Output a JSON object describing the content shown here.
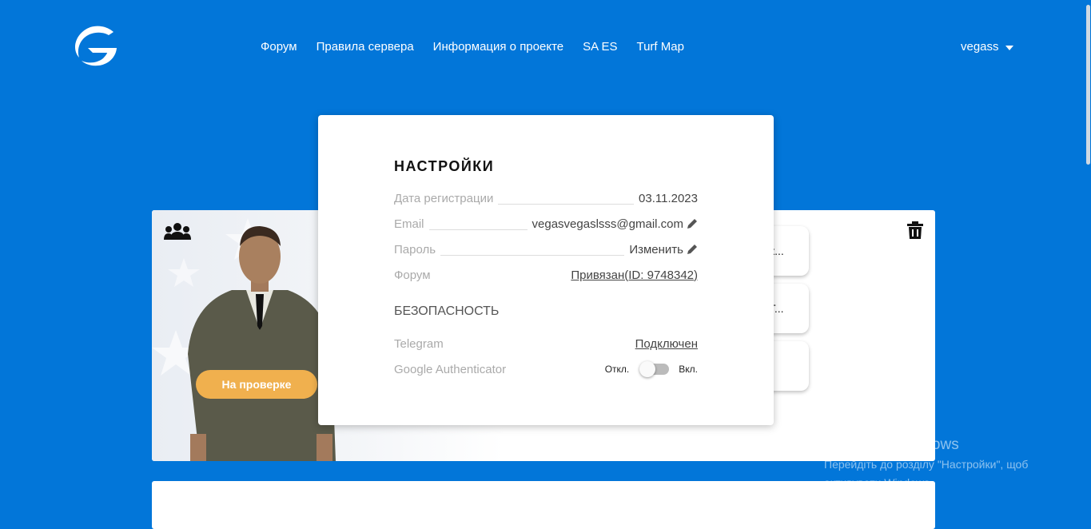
{
  "nav": {
    "items": [
      "Форум",
      "Правила сервера",
      "Информация о проекте",
      "SA ES",
      "Turf Map"
    ],
    "user": "vegass"
  },
  "profile": {
    "status": "На проверке",
    "side_buttons": [
      "к...",
      "Г...",
      ""
    ]
  },
  "settings": {
    "title": "НАСТРОЙКИ",
    "reg_label": "Дата регистрации",
    "reg_value": "03.11.2023",
    "email_label": "Email",
    "email_value": "vegasvegaslsss@gmail.com",
    "password_label": "Пароль",
    "password_value": "Изменить",
    "forum_label": "Форум",
    "forum_value": "Привязан(ID: 9748342)",
    "security_title": "БЕЗОПАСНОСТЬ",
    "telegram_label": "Telegram",
    "telegram_value": "Подключен",
    "ga_label": "Google Authenticator",
    "ga_off": "Откл.",
    "ga_on": "Вкл."
  },
  "watermark": {
    "title": "Активація Windows",
    "line1": "Перейдіть до розділу \"Настройки\", щоб",
    "line2": "активувати Windows."
  },
  "colors": {
    "primary": "#0276d9",
    "status": "#f0b04e"
  },
  "icons": [
    "logo-icon",
    "caret-down-icon",
    "group-icon",
    "trash-icon",
    "pencil-icon"
  ]
}
